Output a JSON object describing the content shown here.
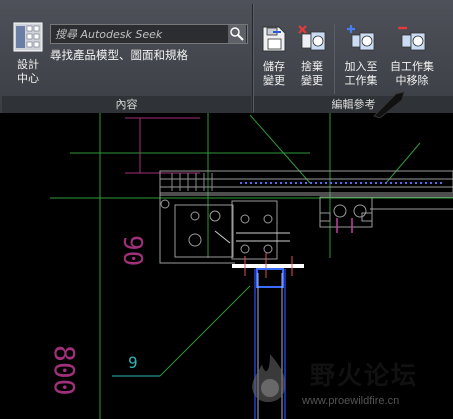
{
  "ribbon": {
    "content_panel": {
      "title": "內容",
      "design_center_label_1": "設計",
      "design_center_label_2": "中心",
      "seek_placeholder": "搜尋 Autodesk Seek",
      "seek_caption": "尋找產品模型、圖面和規格"
    },
    "edit_reference_panel": {
      "title": "編輯參考",
      "save_changes_1": "儲存",
      "save_changes_2": "變更",
      "discard_changes_1": "捨棄",
      "discard_changes_2": "變更",
      "add_to_working_set_1": "加入至",
      "add_to_working_set_2": "工作集",
      "remove_from_working_set_1": "自工作集",
      "remove_from_working_set_2": "中移除"
    }
  },
  "drawing": {
    "dim_90": "90",
    "dim_9": "9",
    "dim_800": "800"
  },
  "watermark": {
    "text": "野火论坛",
    "url": "www.proewildfire.cn"
  },
  "colors": {
    "ribbon_bg": "#45484f",
    "canvas_bg": "#000000",
    "dim_magenta": "#a0307a",
    "dim_cyan": "#2fb4b4",
    "geometry_gray": "#9a9a9a",
    "geometry_white": "#ffffff",
    "geometry_blue": "#3050ff",
    "geometry_green": "#2e9a3a"
  }
}
